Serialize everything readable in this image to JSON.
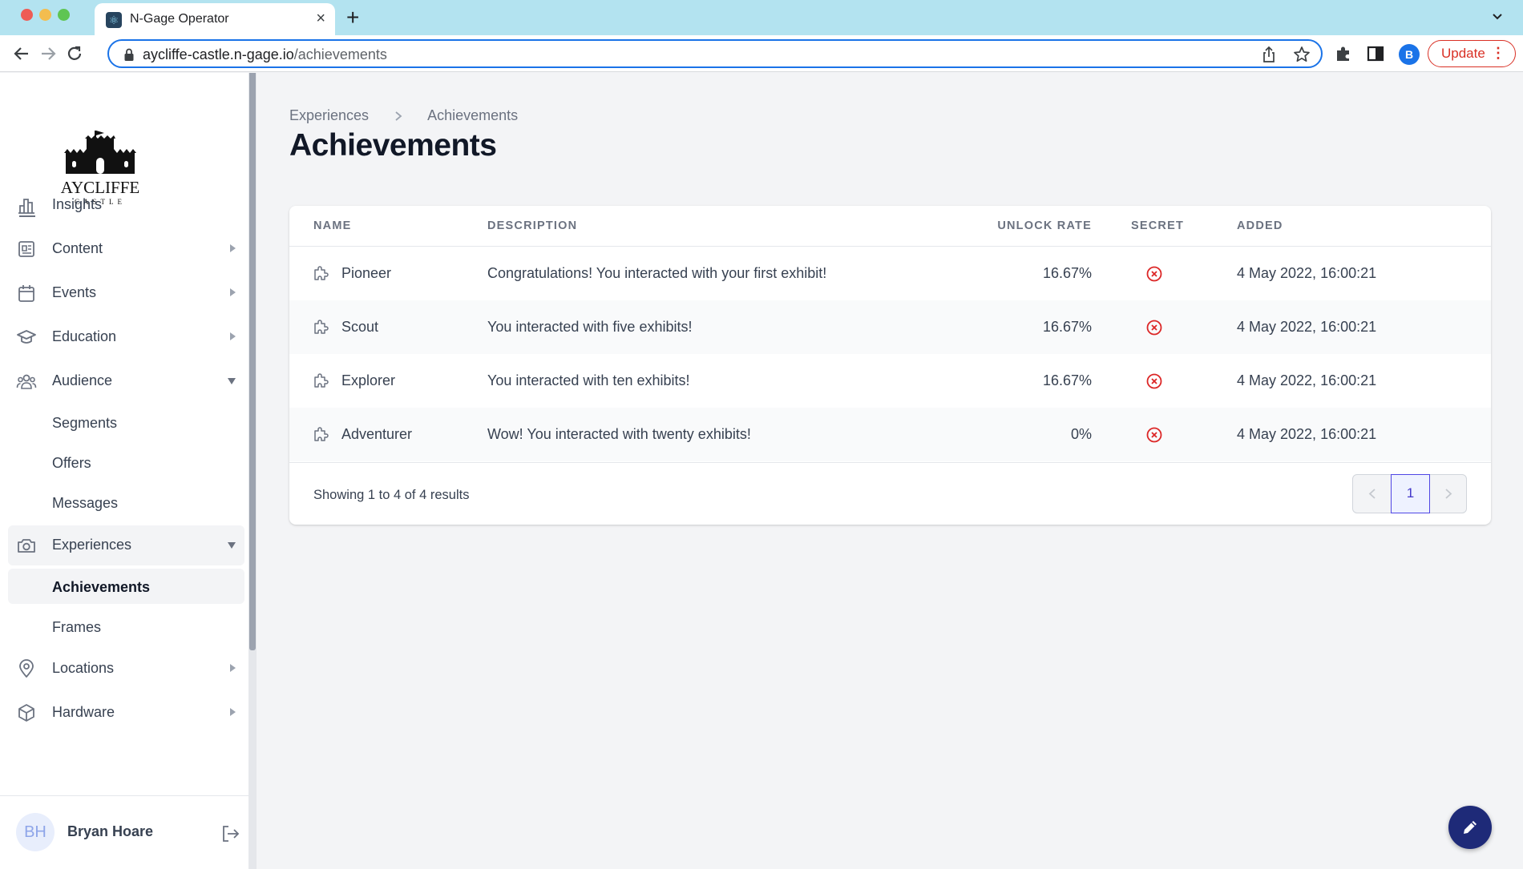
{
  "browser": {
    "tab_title": "N-Gage Operator",
    "url_host": "aycliffe-castle.n-gage.io",
    "url_path": "/achievements",
    "profile_initial": "B",
    "update_label": "Update"
  },
  "sidebar": {
    "logo_text": "AYCLIFFE",
    "logo_subtext": "CASTLE",
    "items": [
      {
        "label": "Insights",
        "icon": "bar-chart-icon"
      },
      {
        "label": "Content",
        "icon": "document-icon"
      },
      {
        "label": "Events",
        "icon": "calendar-icon"
      },
      {
        "label": "Education",
        "icon": "graduation-cap-icon"
      },
      {
        "label": "Audience",
        "icon": "users-icon"
      },
      {
        "label": "Experiences",
        "icon": "camera-icon"
      },
      {
        "label": "Locations",
        "icon": "location-pin-icon"
      },
      {
        "label": "Hardware",
        "icon": "cube-icon"
      }
    ],
    "audience_sub": [
      "Segments",
      "Offers",
      "Messages"
    ],
    "experiences_sub": [
      "Achievements",
      "Frames"
    ],
    "user": {
      "initials": "BH",
      "name": "Bryan Hoare"
    }
  },
  "breadcrumb": [
    "Experiences",
    "Achievements"
  ],
  "page_title": "Achievements",
  "table": {
    "columns": [
      "NAME",
      "DESCRIPTION",
      "UNLOCK RATE",
      "SECRET",
      "ADDED"
    ],
    "rows": [
      {
        "name": "Pioneer",
        "description": "Congratulations! You interacted with your first exhibit!",
        "unlock_rate": "16.67%",
        "secret": false,
        "added": "4 May 2022, 16:00:21"
      },
      {
        "name": "Scout",
        "description": "You interacted with five exhibits!",
        "unlock_rate": "16.67%",
        "secret": false,
        "added": "4 May 2022, 16:00:21"
      },
      {
        "name": "Explorer",
        "description": "You interacted with ten exhibits!",
        "unlock_rate": "16.67%",
        "secret": false,
        "added": "4 May 2022, 16:00:21"
      },
      {
        "name": "Adventurer",
        "description": "Wow! You interacted with twenty exhibits!",
        "unlock_rate": "0%",
        "secret": false,
        "added": "4 May 2022, 16:00:21"
      }
    ],
    "summary": "Showing 1 to 4 of 4 results",
    "current_page": "1"
  },
  "colors": {
    "accent": "#4f46e5",
    "fab": "#1e2a78",
    "secret_no": "#dc2626",
    "chrome_tabbar": "#b3e3f0"
  }
}
